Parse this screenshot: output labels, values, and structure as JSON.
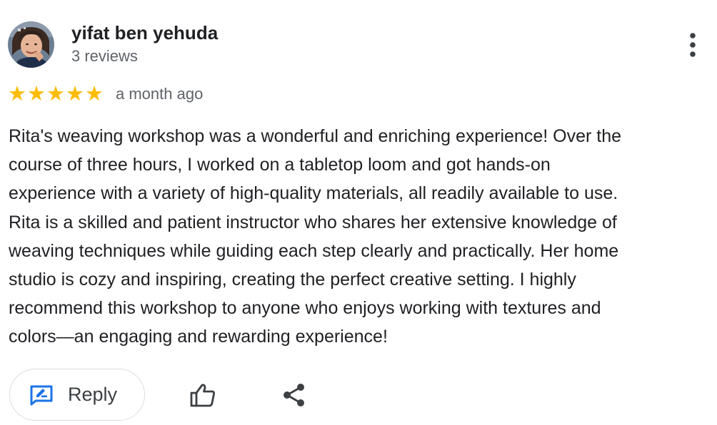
{
  "reviewer": {
    "name": "yifat ben yehuda",
    "review_count": "3 reviews",
    "avatar_icon": "user-avatar-photo"
  },
  "review": {
    "rating": 5,
    "max_rating": 5,
    "date": "a month ago",
    "text_lines": [
      "Rita's weaving workshop was a wonderful and enriching experience! Over the",
      "course of three hours, I worked on a tabletop loom and got hands-on",
      "experience with a variety of high-quality materials, all readily available to use.",
      "Rita is a skilled and patient instructor who shares her extensive knowledge of",
      "weaving techniques while guiding each step clearly and practically. Her home",
      "studio is cozy and inspiring, creating the perfect creative setting. I highly",
      "recommend this workshop to anyone who enjoys working with textures and",
      "colors—an engaging and rewarding experience!"
    ]
  },
  "actions": {
    "reply_label": "Reply",
    "reply_icon": "reply-edit-icon",
    "like_icon": "thumbs-up-icon",
    "share_icon": "share-icon",
    "more_icon": "more-vertical-icon"
  },
  "colors": {
    "star": "#fbbc04",
    "reply_icon": "#1a73e8",
    "primary_text": "#202124",
    "secondary_text": "#5f6368",
    "border": "#dadce0"
  }
}
